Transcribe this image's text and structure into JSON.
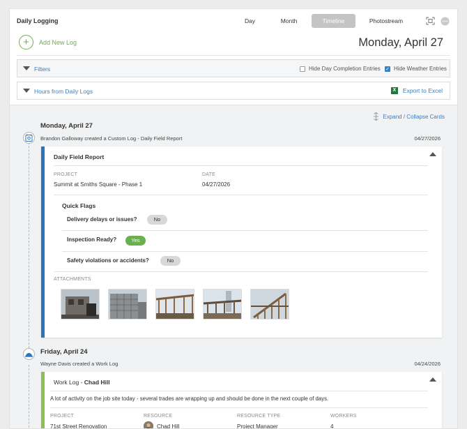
{
  "app": {
    "title": "Daily Logging"
  },
  "view_tabs": [
    {
      "label": "Day",
      "active": false
    },
    {
      "label": "Month",
      "active": false
    },
    {
      "label": "Timeline",
      "active": true
    },
    {
      "label": "Photostream",
      "active": false
    }
  ],
  "header": {
    "add_log_label": "Add New Log",
    "current_date": "Monday, April 27"
  },
  "filters": {
    "label": "Filters",
    "hide_day_completion": {
      "label": "Hide Day Completion Entries",
      "checked": false
    },
    "hide_weather": {
      "label": "Hide Weather Entries",
      "checked": true
    }
  },
  "hours": {
    "label": "Hours from Daily Logs",
    "export_label": "Export to Excel"
  },
  "timeline": {
    "expand_label": "Expand / Collapse Cards",
    "days": [
      {
        "heading": "Monday, April 27",
        "creator_text": "Brandon Galloway created a Custom Log - Daily Field Report",
        "date": "04/27/2026",
        "card": {
          "title": "Daily Field Report",
          "project_label": "PROJECT",
          "project_value": "Summit at Smiths Square - Phase 1",
          "date_label": "DATE",
          "date_value": "04/27/2026",
          "quick_flags_title": "Quick Flags",
          "flags": [
            {
              "question": "Delivery delays or issues?",
              "answer": "No"
            },
            {
              "question": "Inspection Ready?",
              "answer": "Yes"
            },
            {
              "question": "Safety violations or accidents?",
              "answer": "No"
            }
          ],
          "attachments_label": "ATTACHMENTS"
        }
      },
      {
        "heading": "Friday, April 24",
        "creator_text": "Wayne Davis created a Work Log",
        "date": "04/24/2026",
        "card": {
          "title_prefix": "Work Log - ",
          "title_name": "Chad Hill",
          "description": "A lot of activity on the job site today - several trades are wrapping up and should be done in the next couple of days.",
          "project_label": "PROJECT",
          "project_value": "71st Street Renovation",
          "resource_label": "RESOURCE",
          "resource_value": "Chad Hill",
          "resource_type_label": "RESOURCE TYPE",
          "resource_type_value": "Project Manager",
          "workers_label": "WORKERS",
          "workers_value": "4"
        }
      }
    ]
  },
  "colors": {
    "green": "#6ab04c",
    "blue": "#2c74bd",
    "link": "#3a7fbf",
    "lime": "#8cc152"
  }
}
